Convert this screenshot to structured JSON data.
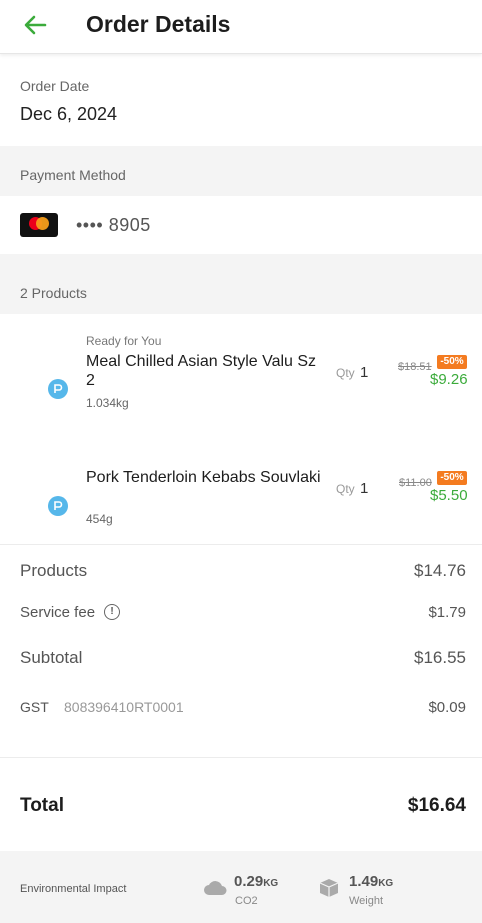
{
  "header": {
    "title": "Order Details",
    "back_icon": "arrow-left-icon",
    "accent": "#3bab3b"
  },
  "order_date": {
    "label": "Order Date",
    "value": "Dec 6, 2024"
  },
  "payment": {
    "label": "Payment Method",
    "card_icon": "mastercard-icon",
    "masked_number": "•••• 8905"
  },
  "products_section": {
    "label": "2 Products"
  },
  "products": [
    {
      "tag": "Ready for You",
      "name": "Meal Chilled Asian Style Valu Sz 2",
      "weight": "1.034kg",
      "qty_label": "Qty",
      "qty": "1",
      "old_price": "$18.51",
      "discount": "-50%",
      "price": "$9.26"
    },
    {
      "tag": "",
      "name": "Pork Tenderloin Kebabs Souvlaki",
      "weight": "454g",
      "qty_label": "Qty",
      "qty": "1",
      "old_price": "$11.00",
      "discount": "-50%",
      "price": "$5.50"
    }
  ],
  "summary": {
    "products_label": "Products",
    "products_value": "$14.76",
    "service_label": "Service fee",
    "service_value": "$1.79",
    "subtotal_label": "Subtotal",
    "subtotal_value": "$16.55",
    "gst_label": "GST",
    "gst_number": "808396410RT0001",
    "gst_value": "$0.09",
    "total_label": "Total",
    "total_value": "$16.64"
  },
  "environment": {
    "label": "Environmental Impact",
    "co2_value": "0.29",
    "co2_unit": "KG",
    "co2_label": "CO2",
    "weight_value": "1.49",
    "weight_unit": "KG",
    "weight_label": "Weight"
  }
}
